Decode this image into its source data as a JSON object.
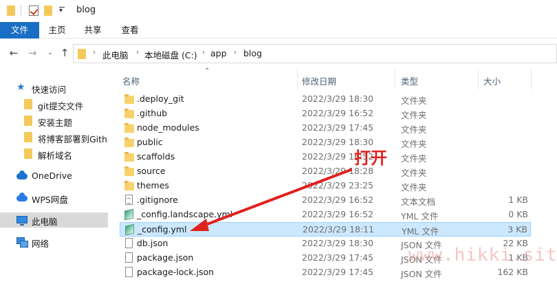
{
  "window": {
    "title": "blog"
  },
  "ribbon": {
    "tabs": [
      "文件",
      "主页",
      "共享",
      "查看"
    ]
  },
  "address": {
    "crumbs": [
      "此电脑",
      "本地磁盘 (C:)",
      "app",
      "blog"
    ]
  },
  "nav": {
    "quick_access": "快速访问",
    "pinned": [
      "git提交文件",
      "安装主题",
      "将博客部署到Githu",
      "解析域名"
    ],
    "onedrive": "OneDrive",
    "wps": "WPS网盘",
    "this_pc": "此电脑",
    "network": "网络"
  },
  "columns": {
    "name": "名称",
    "date": "修改日期",
    "type": "类型",
    "size": "大小"
  },
  "files": [
    {
      "name": ".deploy_git",
      "date": "2022/3/29 18:30",
      "type": "文件夹",
      "size": "",
      "icon": "folder-icon"
    },
    {
      "name": ".github",
      "date": "2022/3/29 16:52",
      "type": "文件夹",
      "size": "",
      "icon": "folder-icon"
    },
    {
      "name": "node_modules",
      "date": "2022/3/29 17:45",
      "type": "文件夹",
      "size": "",
      "icon": "folder-icon"
    },
    {
      "name": "public",
      "date": "2022/3/29 18:30",
      "type": "文件夹",
      "size": "",
      "icon": "folder-icon"
    },
    {
      "name": "scaffolds",
      "date": "2022/3/29 16:52",
      "type": "文件夹",
      "size": "",
      "icon": "folder-icon"
    },
    {
      "name": "source",
      "date": "2022/3/29 18:28",
      "type": "文件夹",
      "size": "",
      "icon": "folder-icon"
    },
    {
      "name": "themes",
      "date": "2022/3/29 23:25",
      "type": "文件夹",
      "size": "",
      "icon": "folder-icon"
    },
    {
      "name": ".gitignore",
      "date": "2022/3/29 16:52",
      "type": "文本文档",
      "size": "1 KB",
      "icon": "text-file-icon"
    },
    {
      "name": "_config.landscape.yml",
      "date": "2022/3/29 16:52",
      "type": "YML 文件",
      "size": "0 KB",
      "icon": "yml-file-icon"
    },
    {
      "name": "_config.yml",
      "date": "2022/3/29 18:11",
      "type": "YML 文件",
      "size": "3 KB",
      "icon": "yml-file-icon",
      "selected": true
    },
    {
      "name": "db.json",
      "date": "2022/3/29 18:30",
      "type": "JSON 文件",
      "size": "22 KB",
      "icon": "json-file-icon"
    },
    {
      "name": "package.json",
      "date": "2022/3/29 17:45",
      "type": "JSON 文件",
      "size": "1 KB",
      "icon": "json-file-icon"
    },
    {
      "name": "package-lock.json",
      "date": "2022/3/29 17:45",
      "type": "JSON 文件",
      "size": "162 KB",
      "icon": "json-file-icon"
    }
  ],
  "annotation": {
    "text": "打开",
    "color": "#e0221f"
  },
  "watermark": "www.hikki.site",
  "colors": {
    "accent": "#1a6fc4",
    "selection": "#cce8ff",
    "selection_border": "#99d1ff"
  }
}
